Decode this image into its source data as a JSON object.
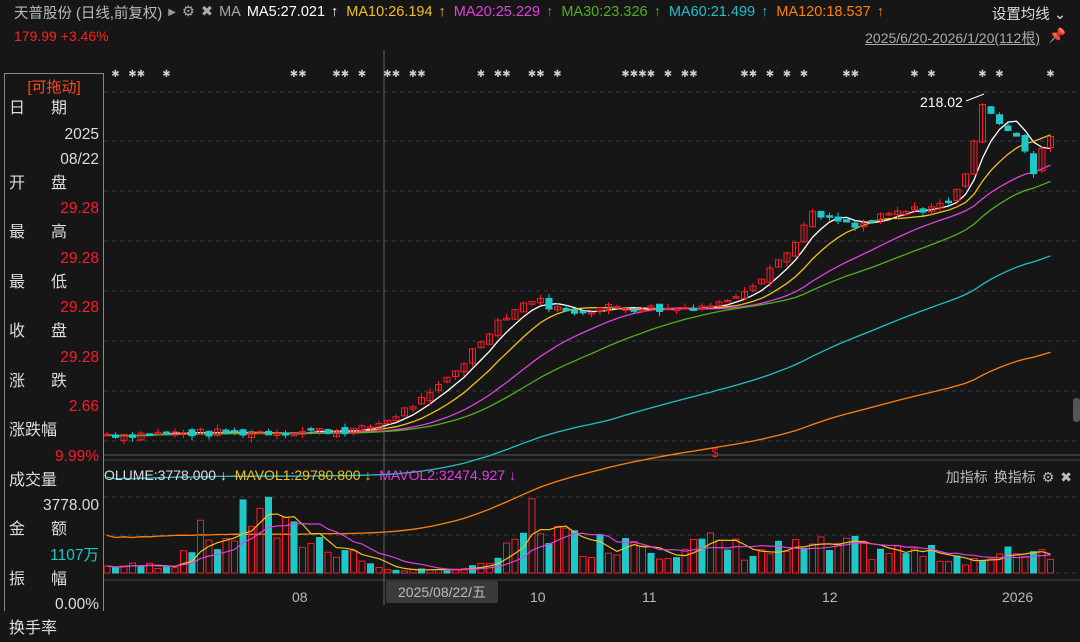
{
  "header": {
    "title": "天普股份 (日线,前复权)",
    "ma_label": "MA",
    "ma": [
      {
        "label": "MA5:27.021",
        "color": "#ffffff"
      },
      {
        "label": "MA10:26.194",
        "color": "#f0c020"
      },
      {
        "label": "MA20:25.229",
        "color": "#e040e0"
      },
      {
        "label": "MA30:23.326",
        "color": "#50b020"
      },
      {
        "label": "MA60:21.499",
        "color": "#20c0c8"
      },
      {
        "label": "MA120:18.537",
        "color": "#ff8010"
      }
    ],
    "ma_arrow": "↑",
    "set_ma": "设置均线",
    "price_change": "179.99 +3.46%",
    "range": "2025/6/20-2026/1/20(112根)"
  },
  "left_panel": {
    "drag": "[可拖动]",
    "date_label": [
      "日",
      "期"
    ],
    "year": "2025",
    "date": "08/22",
    "open_label": [
      "开",
      "盘"
    ],
    "open": "29.28",
    "high_label": [
      "最",
      "高"
    ],
    "high": "29.28",
    "low_label": [
      "最",
      "低"
    ],
    "low": "29.28",
    "close_label": [
      "收",
      "盘"
    ],
    "close": "29.28",
    "chg_label": [
      "涨",
      "跌"
    ],
    "chg": "2.66",
    "pct_label": "涨跌幅",
    "pct": "9.99%",
    "vol_label": "成交量",
    "vol": "3778.00",
    "amt_label": [
      "金",
      "额"
    ],
    "amt": "1107万",
    "amp_label": [
      "振",
      "幅"
    ],
    "amp": "0.00%",
    "turn_label": "换手率"
  },
  "chart": {
    "max_label": "218.02",
    "signal": "$",
    "markers": "✱",
    "price_keypoints": [
      [
        0,
        26.8
      ],
      [
        20,
        27.2
      ],
      [
        30,
        27.6
      ],
      [
        33,
        29.28
      ],
      [
        38,
        34
      ],
      [
        42,
        42
      ],
      [
        46,
        54
      ],
      [
        50,
        62
      ],
      [
        54,
        57
      ],
      [
        60,
        59
      ],
      [
        66,
        58
      ],
      [
        72,
        60
      ],
      [
        76,
        68
      ],
      [
        80,
        82
      ],
      [
        83,
        104
      ],
      [
        86,
        100
      ],
      [
        88,
        96
      ],
      [
        92,
        104
      ],
      [
        96,
        108
      ],
      [
        99,
        112
      ],
      [
        101,
        135
      ],
      [
        102,
        160
      ],
      [
        103,
        210
      ],
      [
        105,
        185
      ],
      [
        107,
        168
      ],
      [
        109,
        135
      ],
      [
        111,
        172
      ]
    ],
    "volume_keypoints": [
      [
        0,
        8
      ],
      [
        8,
        10
      ],
      [
        10,
        45
      ],
      [
        14,
        40
      ],
      [
        16,
        60
      ],
      [
        18,
        95
      ],
      [
        20,
        50
      ],
      [
        24,
        40
      ],
      [
        28,
        30
      ],
      [
        32,
        5
      ],
      [
        38,
        3
      ],
      [
        44,
        8
      ],
      [
        48,
        30
      ],
      [
        50,
        70
      ],
      [
        54,
        40
      ],
      [
        58,
        35
      ],
      [
        62,
        45
      ],
      [
        66,
        30
      ],
      [
        72,
        35
      ],
      [
        76,
        25
      ],
      [
        82,
        30
      ],
      [
        88,
        30
      ],
      [
        94,
        25
      ],
      [
        100,
        20
      ],
      [
        104,
        15
      ],
      [
        108,
        30
      ],
      [
        111,
        25
      ]
    ]
  },
  "volume": {
    "volume": "OLUME:3778.000",
    "mavol1": "MAVOL1:29780.800",
    "mavol2": "MAVOL2:32474.927",
    "down": "↓",
    "add_indicator": "加指标",
    "switch_indicator": "换指标"
  },
  "xaxis": {
    "labels": [
      "08",
      "10",
      "11",
      "12",
      "2026"
    ],
    "cross_date": "2025/08/22/五"
  }
}
